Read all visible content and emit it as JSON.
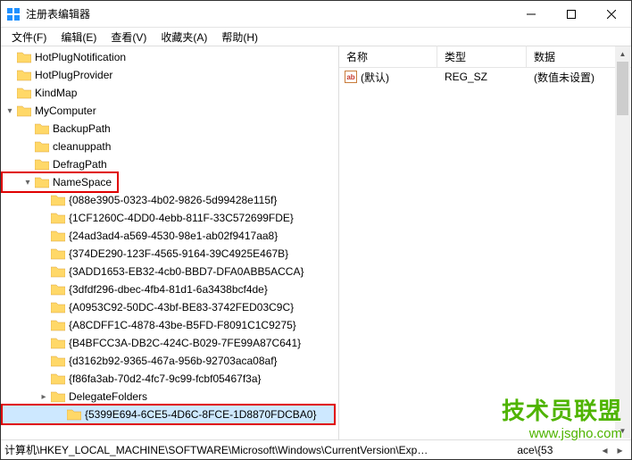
{
  "window": {
    "title": "注册表编辑器"
  },
  "menu": {
    "file": "文件(F)",
    "edit": "编辑(E)",
    "view": "查看(V)",
    "fav": "收藏夹(A)",
    "help": "帮助(H)"
  },
  "tree": {
    "hotplugnotif": "HotPlugNotification",
    "hotplugprov": "HotPlugProvider",
    "kindmap": "KindMap",
    "mycomputer": "MyComputer",
    "backuppath": "BackupPath",
    "cleanuppath": "cleanuppath",
    "defragpath": "DefragPath",
    "namespace": "NameSpace",
    "g1": "{088e3905-0323-4b02-9826-5d99428e115f}",
    "g2": "{1CF1260C-4DD0-4ebb-811F-33C572699FDE}",
    "g3": "{24ad3ad4-a569-4530-98e1-ab02f9417aa8}",
    "g4": "{374DE290-123F-4565-9164-39C4925E467B}",
    "g5": "{3ADD1653-EB32-4cb0-BBD7-DFA0ABB5ACCA}",
    "g6": "{3dfdf296-dbec-4fb4-81d1-6a3438bcf4de}",
    "g7": "{A0953C92-50DC-43bf-BE83-3742FED03C9C}",
    "g8": "{A8CDFF1C-4878-43be-B5FD-F8091C1C9275}",
    "g9": "{B4BFCC3A-DB2C-424C-B029-7FE99A87C641}",
    "g10": "{d3162b92-9365-467a-956b-92703aca08af}",
    "g11": "{f86fa3ab-70d2-4fc7-9c99-fcbf05467f3a}",
    "delegate": "DelegateFolders",
    "gsel": "{5399E694-6CE5-4D6C-8FCE-1D8870FDCBA0}"
  },
  "list": {
    "hdr_name": "名称",
    "hdr_type": "类型",
    "hdr_data": "数据",
    "row_default_name": "(默认)",
    "row_default_type": "REG_SZ",
    "row_default_data": "(数值未设置)",
    "icon_text": "ab"
  },
  "status": {
    "path": "计算机\\HKEY_LOCAL_MACHINE\\SOFTWARE\\Microsoft\\Windows\\CurrentVersion\\Exp",
    "path_tail": "ace\\{53"
  },
  "watermark": {
    "line1": "技术员联盟",
    "line2": "www.jsgho.com"
  }
}
